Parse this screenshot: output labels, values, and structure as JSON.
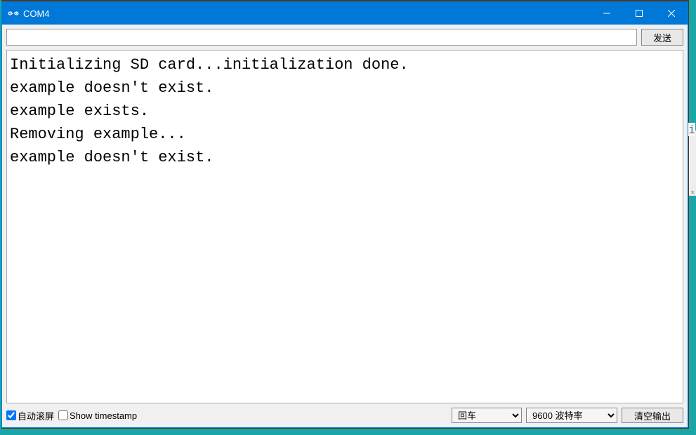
{
  "titlebar": {
    "title": "COM4"
  },
  "toolbar": {
    "input_value": "",
    "send_label": "发送"
  },
  "output": {
    "lines": [
      "Initializing SD card...initialization done.",
      "example doesn't exist.",
      "example exists.",
      "Removing example...",
      "example doesn't exist."
    ]
  },
  "bottombar": {
    "autoscroll_label": "自动滚屏",
    "autoscroll_checked": true,
    "timestamp_label": "Show timestamp",
    "timestamp_checked": false,
    "line_ending_selected": "回车",
    "baud_selected": "9600 波特率",
    "clear_label": "清空输出"
  }
}
